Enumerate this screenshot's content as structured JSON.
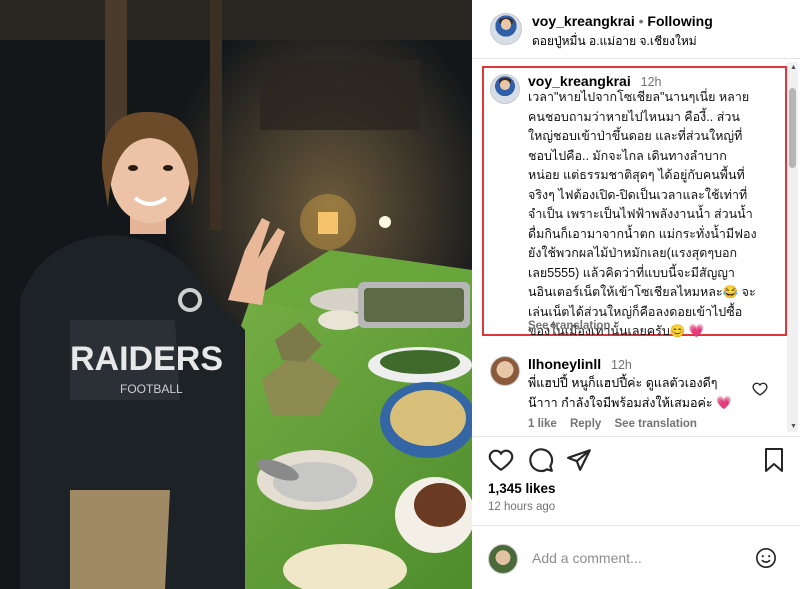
{
  "post": {
    "author": "voy_kreangkrai",
    "follow_state": "Following",
    "location": "ดอยปู่หมื่น อ.แม่อาย จ.เชียงใหม่",
    "likes": "1,345 likes",
    "time_ago": "12 hours ago",
    "add_comment_placeholder": "Add a comment...",
    "photo": {
      "jacket_text": "RAIDERS",
      "jacket_text_sub": "FOOTBALL"
    }
  },
  "comments": [
    {
      "username": "voy_kreangkrai",
      "time": "12h",
      "lines": [
        "เวลา\"หายไปจากโซเชียล\"นานๆเนี่ย หลาย",
        "คนชอบถามว่าหายไปไหนมา คืองี้.. ส่วน",
        "ใหญ่ชอบเข้าป่าขึ้นดอย และที่ส่วนใหญ่ที่",
        "ชอบไปคือ.. มักจะไกล เดินทางลำบาก",
        "หน่อย แต่ธรรมชาติสุดๆ ได้อยู่กับคนพื้นที่",
        "จริงๆ ไฟต้องเปิด-ปิดเป็นเวลาและใช้เท่าที่",
        "จำเป็น เพราะเป็นไฟฟ้าพลังงานน้ำ ส่วนน้ำ",
        "ดื่มกินก็เอามาจากน้ำตก แม่กระทั่งน้ำมีฟอง",
        "ยังใช้พวกผลไม้ป่าหมักเลย(แรงสุดๆบอก",
        "เลย5555) แล้วคิดว่าที่แบบนี้จะมีสัญญา",
        "นอินเตอร์เน็ตให้เข้าโซเชียลไหมหละ😂 จะ",
        "เล่นเน็ตได้ส่วนใหญ่ก็คือลงดอยเข้าไปซื้อ",
        "ของในเมืองเท่านั้นเลยครับ😊 💗"
      ],
      "see_translation": "See translation"
    },
    {
      "username": "llhoneylinll",
      "time": "12h",
      "lines": [
        "พี่แฮปปี้ หนูก็แฮปปี้ค่ะ ดูแลตัวเองดีๆ",
        "น๊าาา กำลังใจมีพร้อมส่งให้เสมอค่ะ 💗"
      ],
      "likes": "1 like",
      "reply": "Reply",
      "see_translation": "See translation"
    }
  ],
  "icons": {
    "like": "heart-outline-icon",
    "comment": "speech-bubble-icon",
    "share": "paper-plane-icon",
    "save": "bookmark-icon",
    "emoji": "smiley-icon"
  },
  "colors": {
    "highlight_border": "#e0353b",
    "muted_text": "#737373"
  }
}
